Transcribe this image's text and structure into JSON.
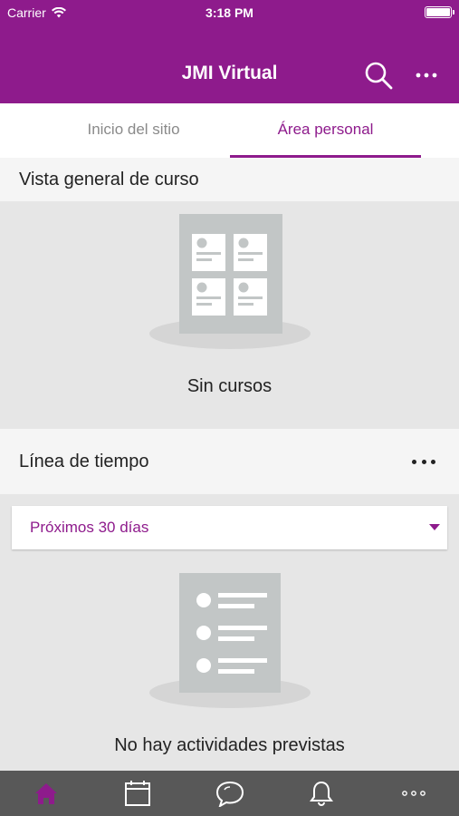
{
  "status_bar": {
    "carrier": "Carrier",
    "time": "3:18 PM"
  },
  "nav": {
    "title": "JMI Virtual",
    "search_icon": "search-icon",
    "more_icon": "more-icon"
  },
  "tabs": {
    "left": "Inicio del sitio",
    "right": "Área personal",
    "active": "right"
  },
  "course_overview": {
    "header": "Vista general de curso",
    "empty_text": "Sin cursos"
  },
  "timeline": {
    "header": "Línea de tiempo",
    "filter_value": "Próximos 30 días",
    "empty_text": "No hay actividades previstas"
  },
  "tab_bar": {
    "items": [
      "home-icon",
      "calendar-icon",
      "messages-icon",
      "notifications-icon",
      "more-icon"
    ],
    "active": "home-icon"
  },
  "colors": {
    "brand": "#8e1b8c",
    "tab_bar": "#585858",
    "background": "#e6e6e6"
  }
}
